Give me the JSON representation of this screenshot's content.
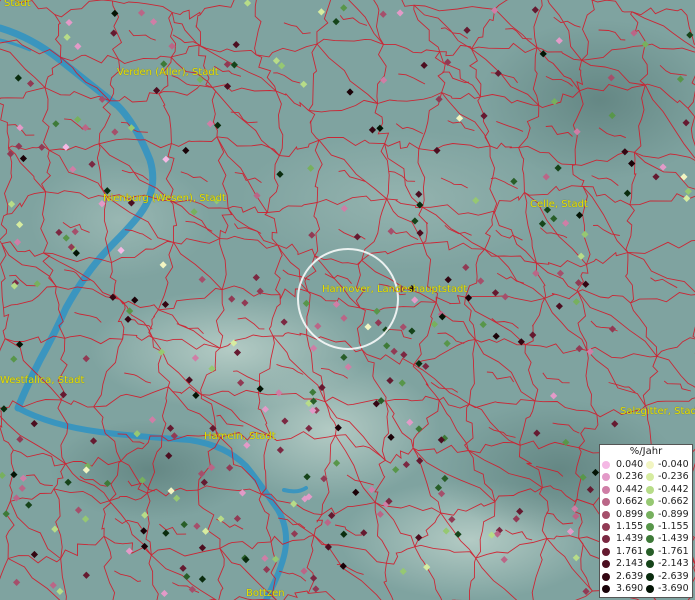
{
  "map": {
    "cities": [
      {
        "name": "Stadt"
      },
      {
        "name": "Verden (Aller), Stadt"
      },
      {
        "name": "Nienburg (Wesen), Stadt"
      },
      {
        "name": "Celle, Stadt"
      },
      {
        "name": "Hannover, Landeshauptstadt"
      },
      {
        "name": "Westfalica, Stadt"
      },
      {
        "name": "Hameln, Stadt"
      },
      {
        "name": "Salzgitter, Stadt"
      },
      {
        "name": "Bottzen"
      }
    ]
  },
  "legend": {
    "title": "%/Jahr",
    "positive": [
      {
        "value": "0.040",
        "color": "#f4b8e4"
      },
      {
        "value": "0.236",
        "color": "#e39ac8"
      },
      {
        "value": "0.442",
        "color": "#cf7ea6"
      },
      {
        "value": "0.662",
        "color": "#ba6687"
      },
      {
        "value": "0.899",
        "color": "#a54f6b"
      },
      {
        "value": "1.155",
        "color": "#913a54"
      },
      {
        "value": "1.439",
        "color": "#7b2842"
      },
      {
        "value": "1.761",
        "color": "#651a30"
      },
      {
        "value": "2.143",
        "color": "#4c0e20"
      },
      {
        "value": "2.639",
        "color": "#340612"
      },
      {
        "value": "3.690",
        "color": "#1a0208"
      }
    ],
    "negative": [
      {
        "value": "-0.040",
        "color": "#f2f5c2"
      },
      {
        "value": "-0.236",
        "color": "#d6eca0"
      },
      {
        "value": "-0.442",
        "color": "#b7dc88"
      },
      {
        "value": "-0.662",
        "color": "#96c872"
      },
      {
        "value": "-0.899",
        "color": "#77b05e"
      },
      {
        "value": "-1.155",
        "color": "#58964a"
      },
      {
        "value": "-1.439",
        "color": "#3e7a38"
      },
      {
        "value": "-1.761",
        "color": "#285e28"
      },
      {
        "value": "-2.143",
        "color": "#16441a"
      },
      {
        "value": "-2.639",
        "color": "#0a2c0e"
      },
      {
        "value": "-3.690",
        "color": "#031405"
      }
    ]
  }
}
